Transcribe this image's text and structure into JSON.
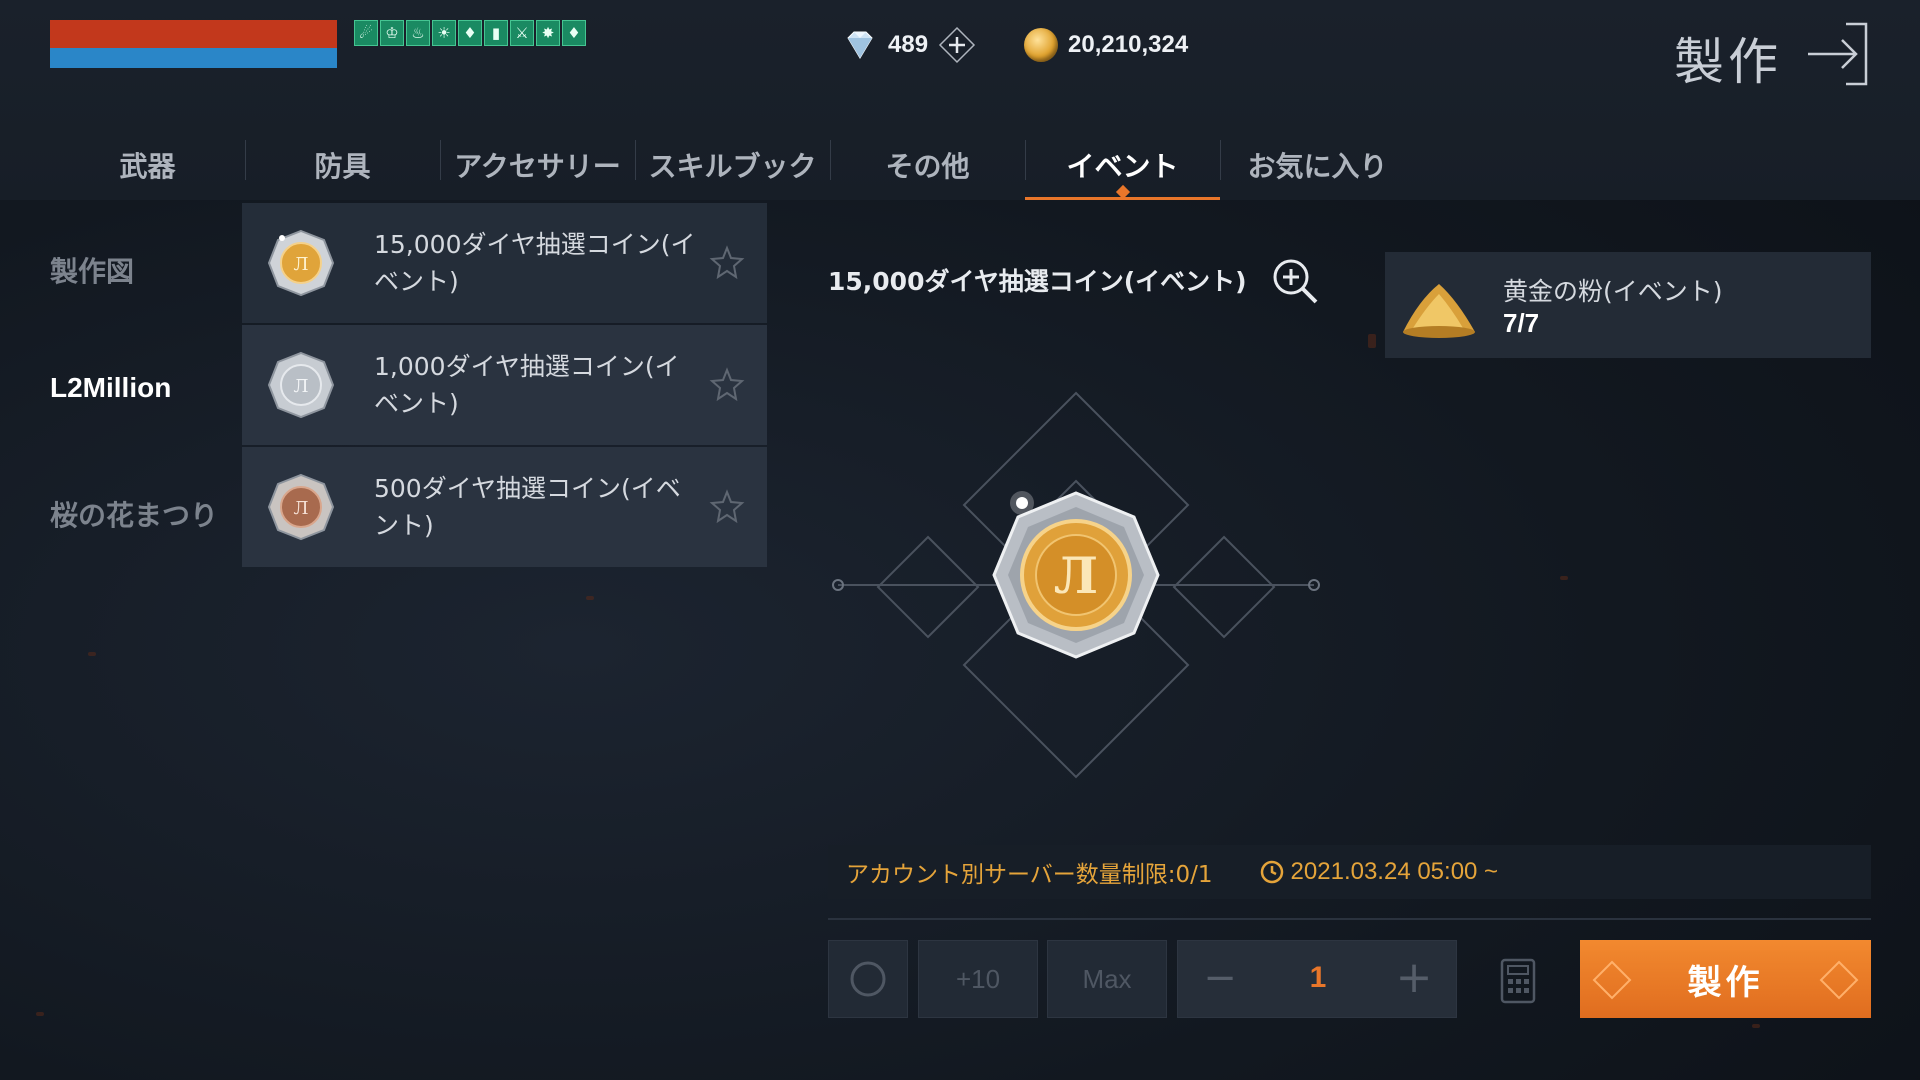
{
  "status": {
    "buff_icons": [
      "☄",
      "♔",
      "♨",
      "☀",
      "♦",
      "▮",
      "⚔",
      "✸",
      "♦"
    ]
  },
  "currency": {
    "diamonds": "489",
    "gold": "20,210,324"
  },
  "header": {
    "title": "製作"
  },
  "tabs": [
    {
      "label": "武器",
      "active": false
    },
    {
      "label": "防具",
      "active": false
    },
    {
      "label": "アクセサリー",
      "active": false
    },
    {
      "label": "スキルブック",
      "active": false
    },
    {
      "label": "その他",
      "active": false
    },
    {
      "label": "イベント",
      "active": true
    },
    {
      "label": "お気に入り",
      "active": false
    }
  ],
  "categories": [
    {
      "label": "製作図",
      "active": false
    },
    {
      "label": "L2Million",
      "active": true
    },
    {
      "label": "桜の花まつり",
      "active": false
    }
  ],
  "items": [
    {
      "name": "15,000ダイヤ抽選コイン(イベント)",
      "coin": "gold",
      "selected": true
    },
    {
      "name": "1,000ダイヤ抽選コイン(イベント)",
      "coin": "silver",
      "selected": false
    },
    {
      "name": "500ダイヤ抽選コイン(イベント)",
      "coin": "bronze",
      "selected": false
    }
  ],
  "detail": {
    "title": "15,000ダイヤ抽選コイン(イベント)",
    "ingredient": {
      "name": "黄金の粉(イベント)",
      "count": "7/7"
    },
    "limit_text": "アカウント別サーバー数量制限:0/1",
    "limit_date": "2021.03.24 05:00 ~"
  },
  "controls": {
    "plus10_label": "+10",
    "max_label": "Max",
    "quantity": "1",
    "craft_label": "製作"
  },
  "colors": {
    "accent": "#e8762a",
    "hp": "#c2381c",
    "mp": "#2a86c8"
  }
}
